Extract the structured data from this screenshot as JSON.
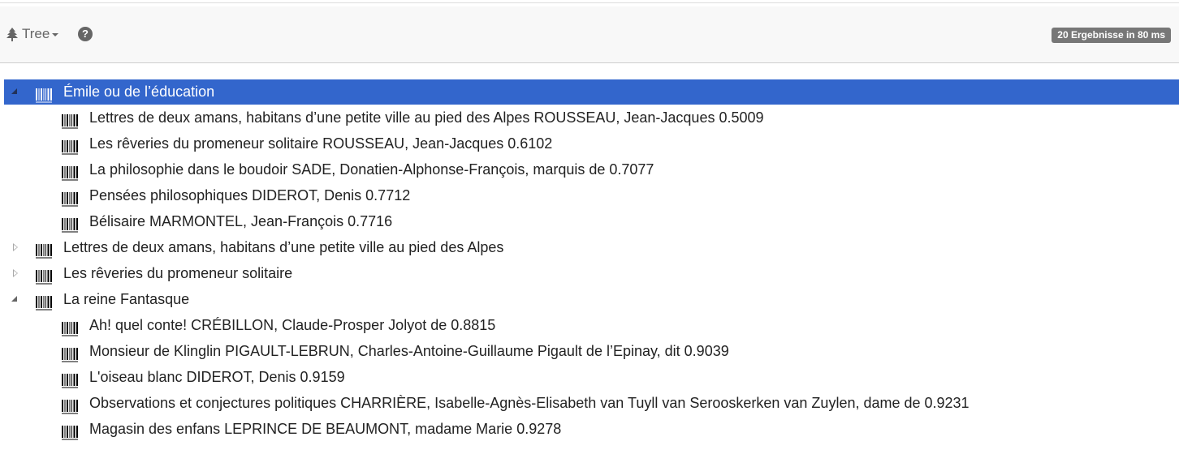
{
  "toolbar": {
    "tree_label": "Tree",
    "tree_icon": "tree-icon",
    "help_icon": "question-circle-icon",
    "help_symbol": "?",
    "results_badge": "20 Ergebnisse in 80 ms"
  },
  "tree": {
    "rows": [
      {
        "label": "Émile ou de l’éducation",
        "level": 0,
        "state": "expanded",
        "selected": true
      },
      {
        "label": "Lettres de deux amans, habitans d’une petite ville au pied des Alpes ROUSSEAU, Jean-Jacques 0.5009",
        "level": 1
      },
      {
        "label": "Les rêveries du promeneur solitaire ROUSSEAU, Jean-Jacques 0.6102",
        "level": 1
      },
      {
        "label": "La philosophie dans le boudoir SADE, Donatien-Alphonse-François, marquis de 0.7077",
        "level": 1
      },
      {
        "label": "Pensées philosophiques DIDEROT, Denis 0.7712",
        "level": 1
      },
      {
        "label": "Bélisaire MARMONTEL, Jean-François 0.7716",
        "level": 1
      },
      {
        "label": "Lettres de deux amans, habitans d’une petite ville au pied des Alpes",
        "level": 0,
        "state": "collapsed"
      },
      {
        "label": "Les rêveries du promeneur solitaire",
        "level": 0,
        "state": "collapsed"
      },
      {
        "label": "La reine Fantasque",
        "level": 0,
        "state": "expanded"
      },
      {
        "label": "Ah! quel conte! CRÉBILLON, Claude-Prosper Jolyot de 0.8815",
        "level": 1
      },
      {
        "label": "Monsieur de Klinglin PIGAULT-LEBRUN, Charles-Antoine-Guillaume Pigault de l’Epinay, dit 0.9039",
        "level": 1
      },
      {
        "label": "L'oiseau blanc DIDEROT, Denis 0.9159",
        "level": 1
      },
      {
        "label": "Observations et conjectures politiques CHARRIÈRE, Isabelle-Agnès-Elisabeth van Tuyll van Serooskerken van Zuylen, dame de 0.9231",
        "level": 1
      },
      {
        "label": "Magasin des enfans LEPRINCE DE BEAUMONT, madame Marie 0.9278",
        "level": 1
      }
    ],
    "row_icon": "barcode-icon"
  },
  "colors": {
    "selection": "#3366cc",
    "badge": "#777777",
    "toolbar_bg": "#f8f8f8"
  }
}
